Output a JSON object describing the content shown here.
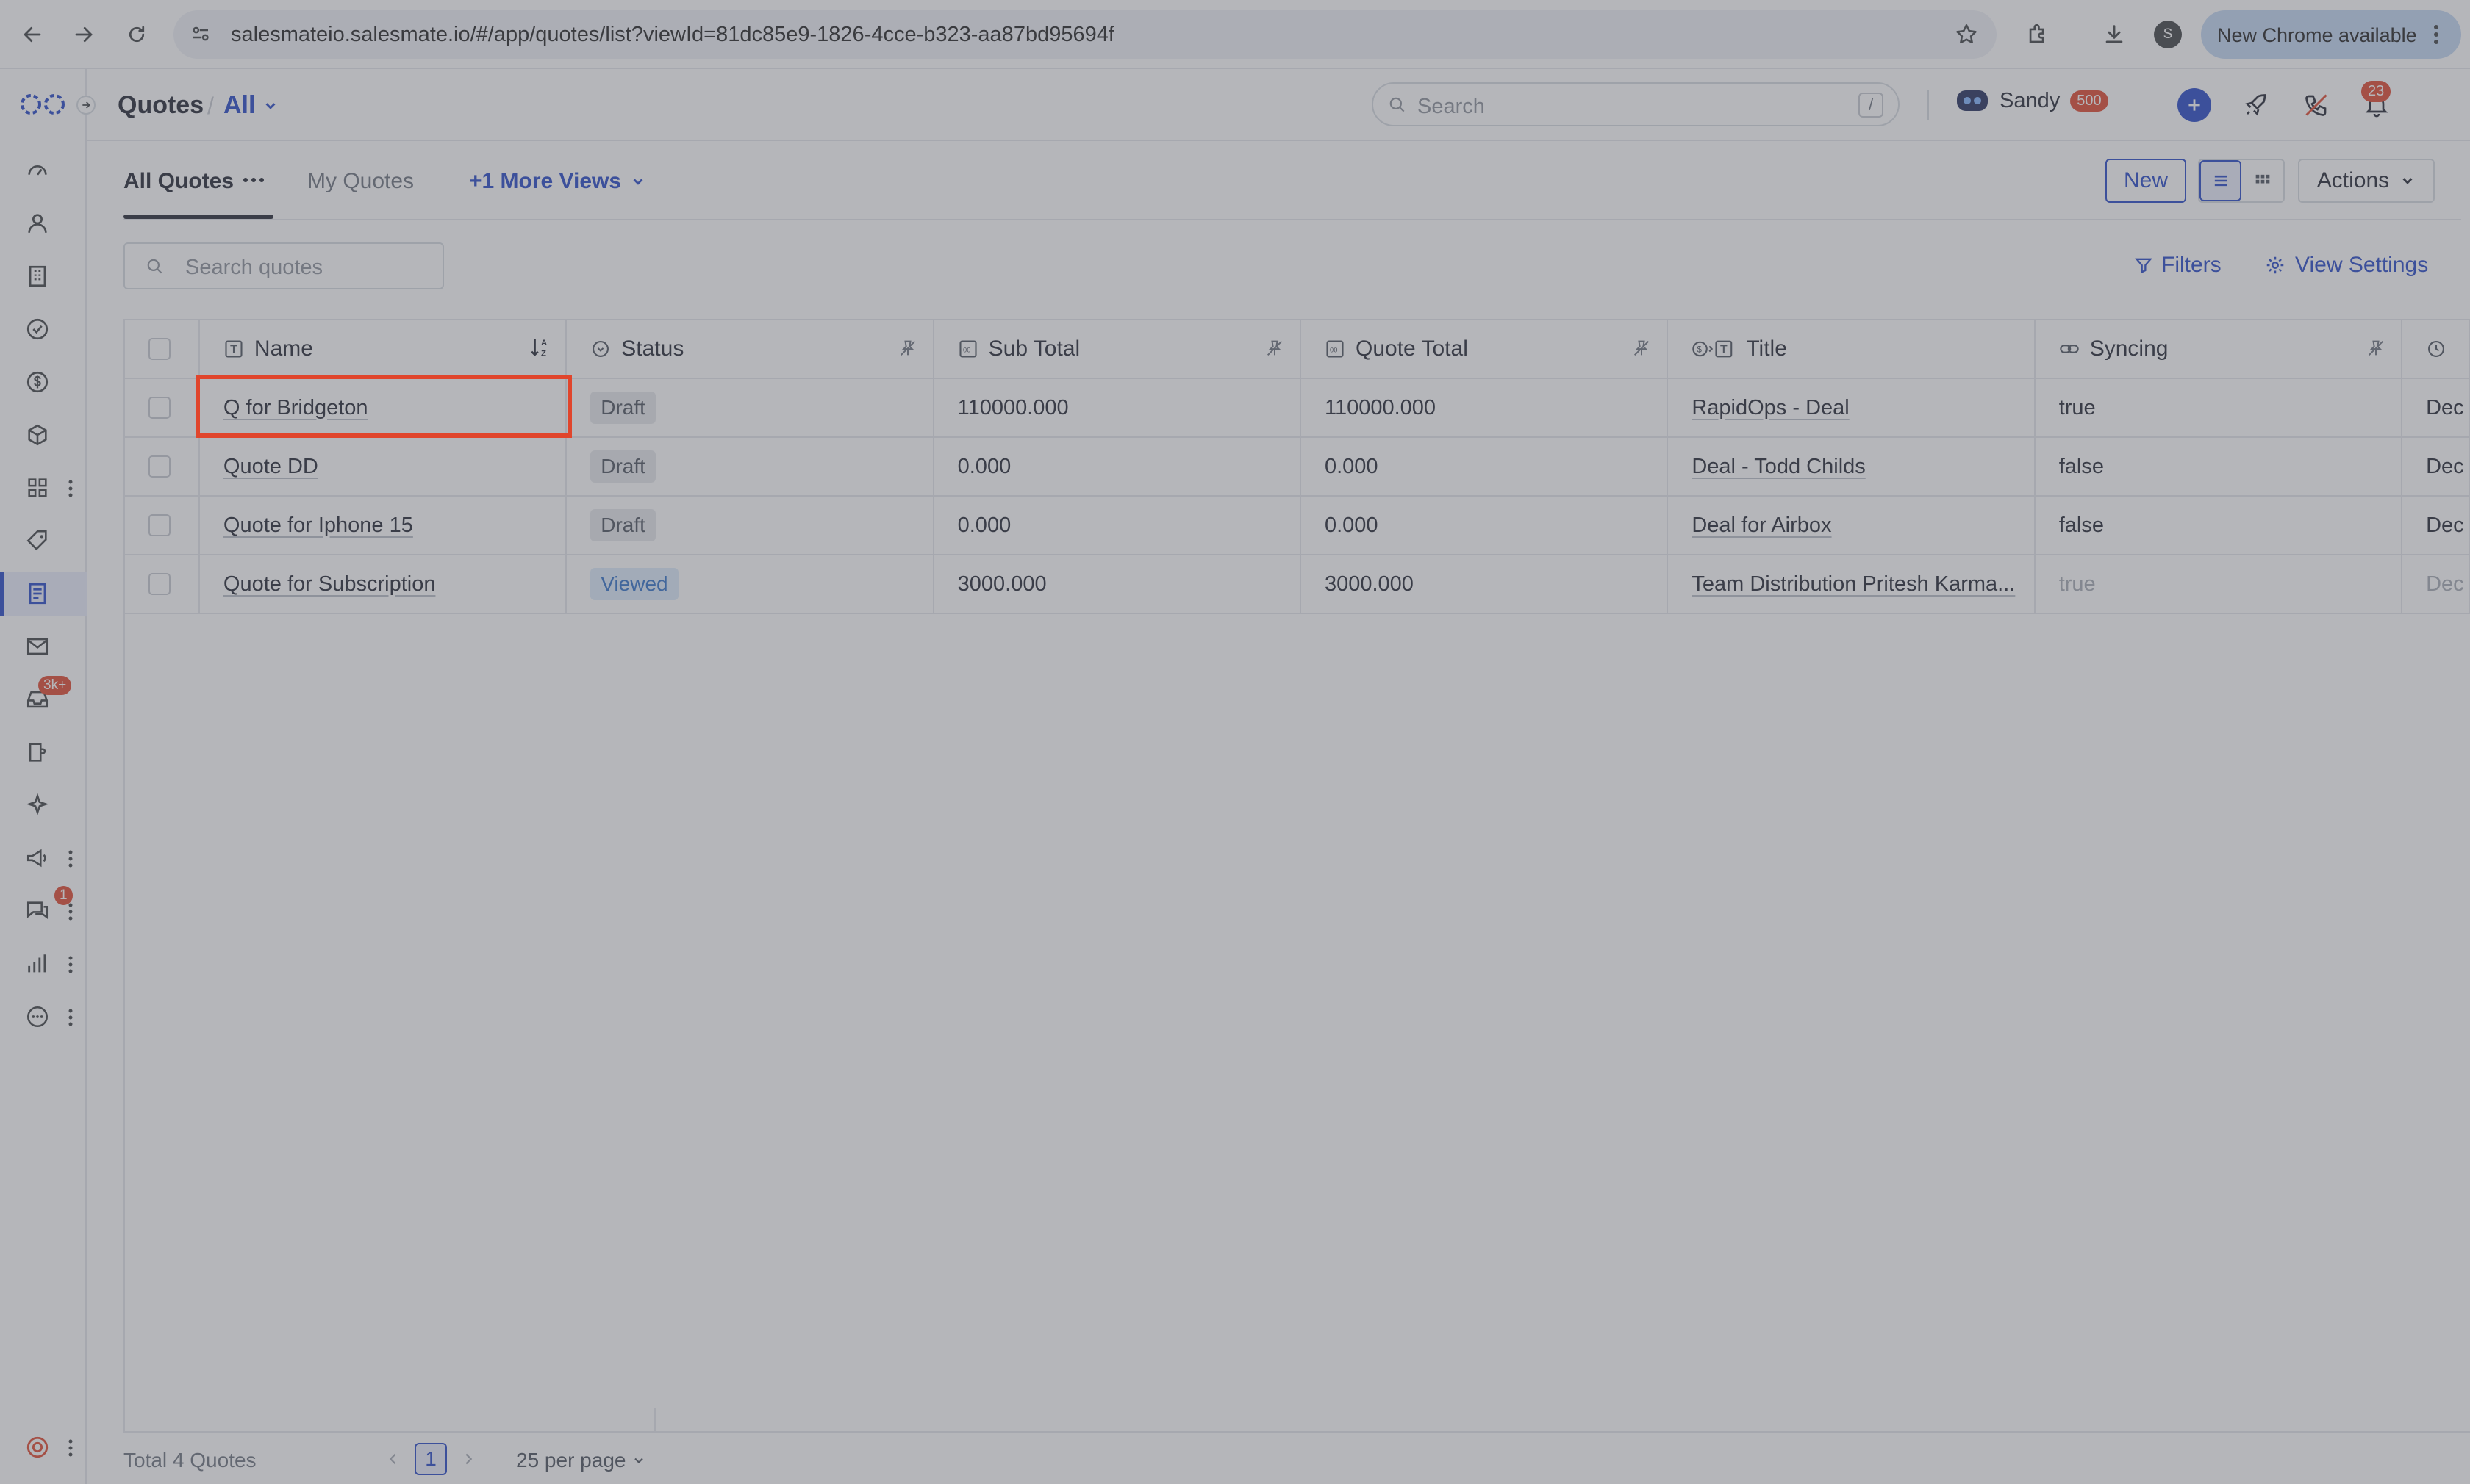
{
  "browser": {
    "url": "salesmateio.salesmate.io/#/app/quotes/list?viewId=81dc85e9-1826-4cce-b323-aa87bd95694f",
    "profile_initial": "S",
    "new_chrome_label": "New Chrome available"
  },
  "header": {
    "module_title": "Quotes",
    "view_selector": "All",
    "search_placeholder": "Search",
    "search_shortcut": "/",
    "user_name": "Sandy",
    "user_badge": "500",
    "notification_count": "23"
  },
  "sidebar": {
    "items": [
      {
        "icon": "dashboard-icon"
      },
      {
        "icon": "contacts-icon"
      },
      {
        "icon": "companies-icon"
      },
      {
        "icon": "tasks-icon"
      },
      {
        "icon": "deals-icon"
      },
      {
        "icon": "products-icon"
      },
      {
        "icon": "apps-icon"
      },
      {
        "icon": "tag-icon"
      },
      {
        "icon": "quotes-icon"
      },
      {
        "icon": "email-icon"
      },
      {
        "icon": "inbox-icon",
        "badge": "3k+"
      },
      {
        "icon": "sequences-icon"
      },
      {
        "icon": "ai-sparkle-icon"
      },
      {
        "icon": "campaigns-icon"
      },
      {
        "icon": "chat-icon",
        "badge": "1"
      },
      {
        "icon": "reports-icon"
      },
      {
        "icon": "more-icon"
      }
    ]
  },
  "tabs": {
    "all_quotes": "All Quotes",
    "my_quotes": "My Quotes",
    "more_views": "+1 More Views"
  },
  "toolbar": {
    "new_label": "New",
    "actions_label": "Actions",
    "search_placeholder": "Search quotes",
    "filters_label": "Filters",
    "view_settings_label": "View Settings"
  },
  "table": {
    "columns": {
      "name": "Name",
      "status": "Status",
      "sub_total": "Sub Total",
      "quote_total": "Quote Total",
      "title": "Title",
      "syncing": "Syncing"
    },
    "rows": [
      {
        "name": "Q for Bridgeton",
        "status": "Draft",
        "sub_total": "110000.000",
        "quote_total": "110000.000",
        "title": "RapidOps - Deal",
        "syncing": "true",
        "more": "Dec"
      },
      {
        "name": "Quote DD",
        "status": "Draft",
        "sub_total": "0.000",
        "quote_total": "0.000",
        "title": "Deal - Todd Childs",
        "syncing": "false",
        "more": "Dec"
      },
      {
        "name": "Quote for Iphone 15",
        "status": "Draft",
        "sub_total": "0.000",
        "quote_total": "0.000",
        "title": "Deal for Airbox",
        "syncing": "false",
        "more": "Dec"
      },
      {
        "name": "Quote for Subscription",
        "status": "Viewed",
        "sub_total": "3000.000",
        "quote_total": "3000.000",
        "title": "Team Distribution Pritesh Karma...",
        "syncing": "true",
        "more": "Dec"
      }
    ]
  },
  "footer": {
    "total": "Total 4 Quotes",
    "page": "1",
    "per_page": "25 per page"
  },
  "colors": {
    "accent": "#2446c6",
    "highlight": "#e0452c",
    "viewed": "#2f6fc8"
  }
}
